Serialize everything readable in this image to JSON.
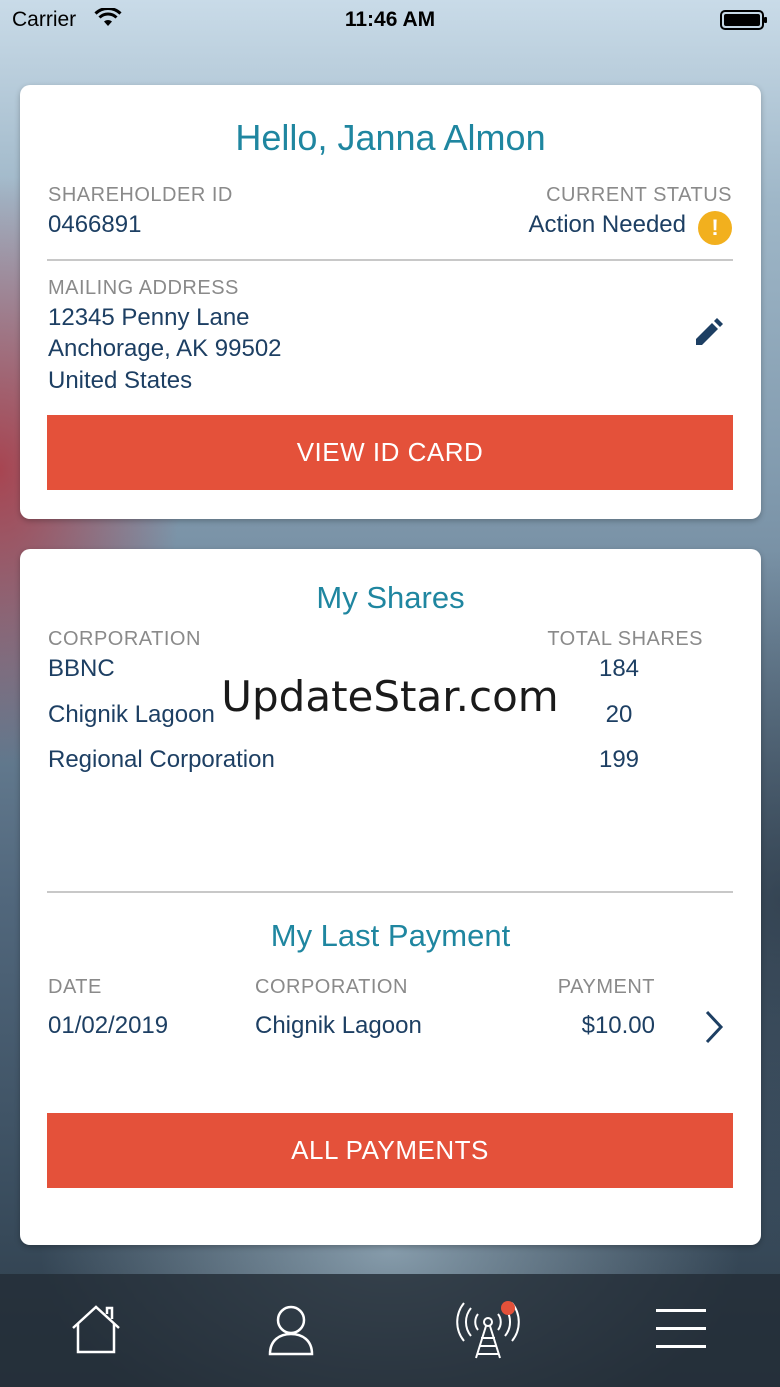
{
  "status_bar": {
    "carrier": "Carrier",
    "time": "11:46 AM"
  },
  "profile": {
    "greeting": "Hello, Janna Almon",
    "shareholder_id_label": "SHAREHOLDER ID",
    "shareholder_id": "0466891",
    "current_status_label": "CURRENT STATUS",
    "current_status": "Action Needed",
    "status_icon": "!",
    "mailing_address_label": "MAILING ADDRESS",
    "address_line1": "12345 Penny Lane",
    "address_line2": "Anchorage, AK 99502",
    "address_line3": "United States",
    "view_id_card_label": "VIEW ID CARD"
  },
  "shares": {
    "title": "My Shares",
    "corporation_header": "CORPORATION",
    "total_shares_header": "TOTAL SHARES",
    "rows": [
      {
        "corporation": "BBNC",
        "total": "184"
      },
      {
        "corporation": "Chignik Lagoon",
        "total": "20"
      },
      {
        "corporation": "Regional Corporation",
        "total": "199"
      }
    ]
  },
  "last_payment": {
    "title": "My Last Payment",
    "date_header": "DATE",
    "corporation_header": "CORPORATION",
    "payment_header": "PAYMENT",
    "date": "01/02/2019",
    "corporation": "Chignik Lagoon",
    "payment": "$10.00",
    "all_payments_label": "ALL PAYMENTS"
  },
  "watermark": "UpdateStar.com",
  "tab_bar": {
    "tabs": [
      {
        "icon": "home-icon"
      },
      {
        "icon": "profile-icon"
      },
      {
        "icon": "broadcast-icon",
        "badge": true
      },
      {
        "icon": "menu-icon"
      }
    ]
  },
  "colors": {
    "accent_teal": "#1f86a0",
    "button_red": "#e4513a",
    "text_navy": "#1d3f63",
    "warning_yellow": "#f2b01e",
    "badge_red": "#e4513a"
  }
}
